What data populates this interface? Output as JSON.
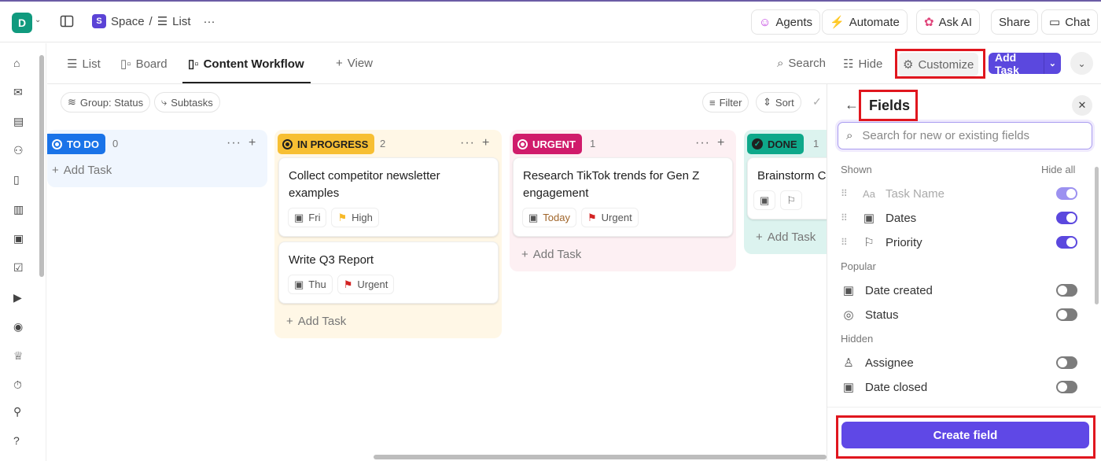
{
  "workspace": {
    "initial": "D"
  },
  "breadcrumb": {
    "space_initial": "S",
    "space": "Space",
    "separator": "/",
    "list": "List",
    "more": "···"
  },
  "topbar": {
    "agents": "Agents",
    "automate": "Automate",
    "ask_ai": "Ask AI",
    "share": "Share",
    "chat": "Chat"
  },
  "tabs": [
    {
      "label": "List"
    },
    {
      "label": "Board"
    },
    {
      "label": "Content Workflow"
    },
    {
      "label": "View"
    }
  ],
  "toolbar": {
    "search": "Search",
    "hide": "Hide",
    "customize": "Customize",
    "add_task": "Add Task"
  },
  "filters": {
    "group": "Group: Status",
    "subtasks": "Subtasks",
    "filter": "Filter",
    "sort": "Sort"
  },
  "columns": [
    {
      "status": "TO DO",
      "count": "0",
      "color": "#1a73e8",
      "bg": "#f0f6fe",
      "add": "Add Task",
      "cards": []
    },
    {
      "status": "IN PROGRESS",
      "count": "2",
      "color": "#f7bf33",
      "bg": "#fff7e6",
      "add": "Add Task",
      "cards": [
        {
          "title": "Collect competitor newsletter examples",
          "date": "Fri",
          "priority": "High"
        },
        {
          "title": "Write Q3 Report",
          "date": "Thu",
          "priority": "Urgent"
        }
      ]
    },
    {
      "status": "URGENT",
      "count": "1",
      "color": "#d01b6b",
      "bg": "#fdf0f3",
      "add": "Add Task",
      "cards": [
        {
          "title": "Research TikTok trends for Gen Z engagement",
          "date": "Today",
          "priority": "Urgent"
        }
      ]
    },
    {
      "status": "DONE",
      "count": "1",
      "color": "#0ea88a",
      "bg": "#dcf3ef",
      "add": "Add Task",
      "cards": [
        {
          "title": "Brainstorm C"
        }
      ]
    }
  ],
  "panel": {
    "title": "Fields",
    "search_placeholder": "Search for new or existing fields",
    "shown_label": "Shown",
    "hide_all": "Hide all",
    "shown": [
      {
        "name": "Task Name",
        "icon": "Aa",
        "on": true
      },
      {
        "name": "Dates",
        "on": true
      },
      {
        "name": "Priority",
        "on": true
      }
    ],
    "popular_label": "Popular",
    "popular": [
      {
        "name": "Date created",
        "on": false
      },
      {
        "name": "Status",
        "on": false
      }
    ],
    "hidden_label": "Hidden",
    "hidden": [
      {
        "name": "Assignee",
        "on": false
      },
      {
        "name": "Date closed",
        "on": false
      }
    ],
    "create_field": "Create field"
  },
  "colors": {
    "accent": "#5b48de",
    "highlight": "#e0161e"
  }
}
